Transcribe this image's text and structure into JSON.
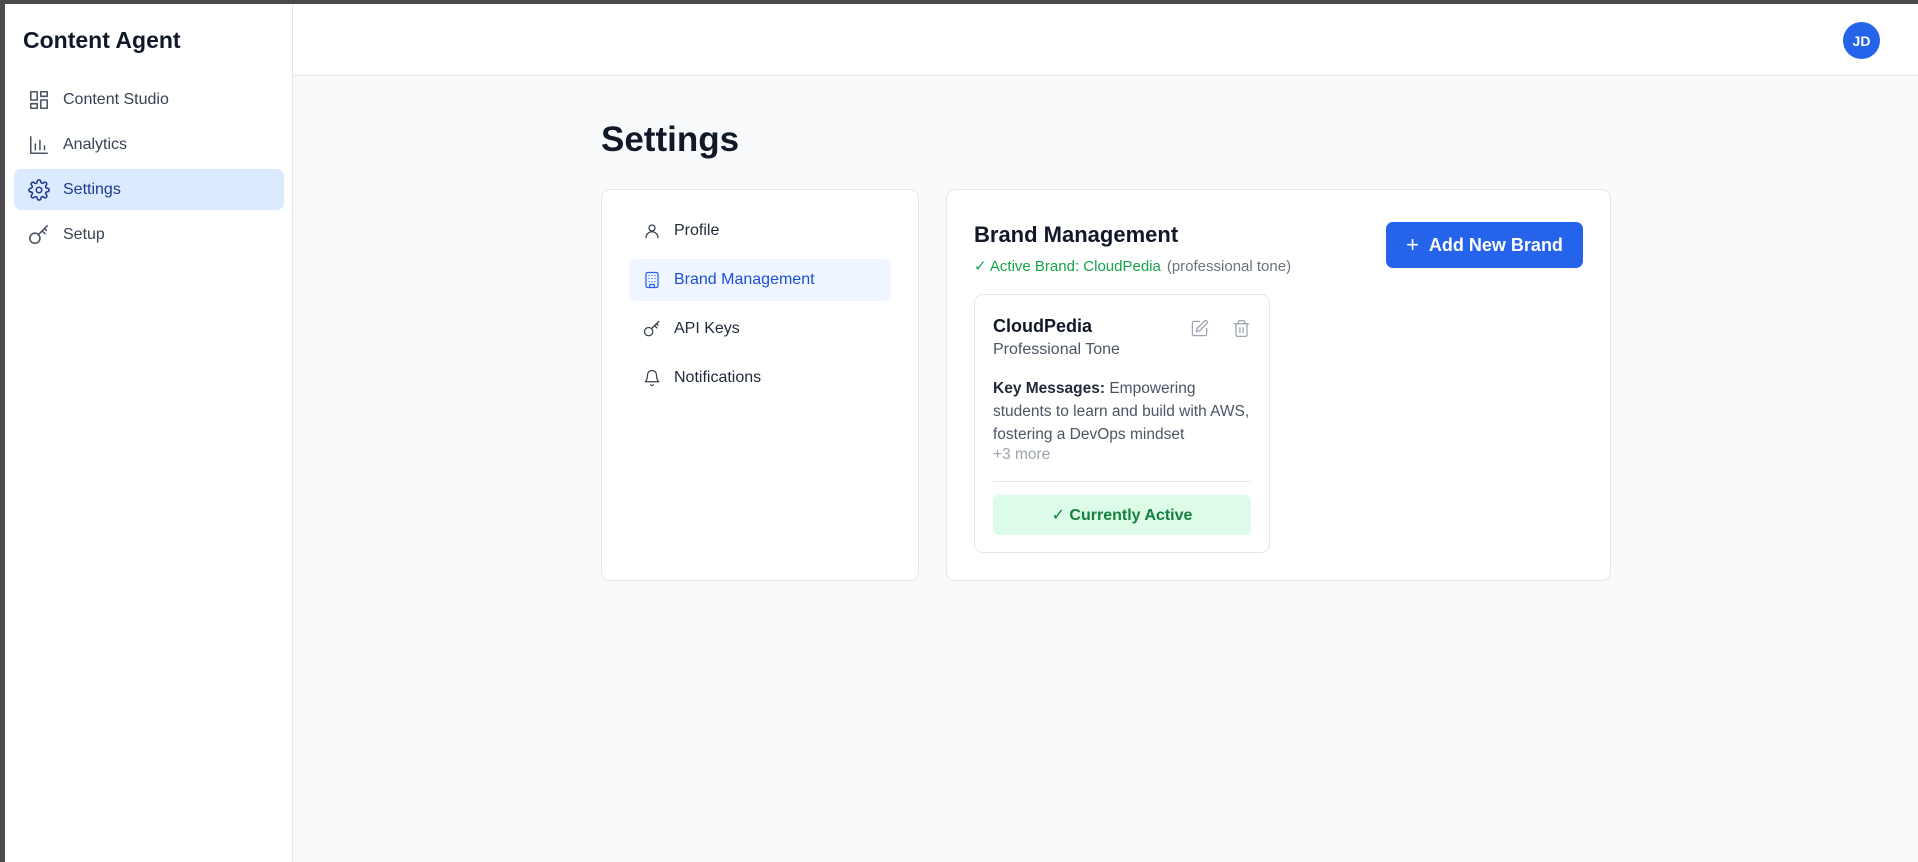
{
  "app": {
    "title": "Content Agent"
  },
  "sidebar": {
    "items": [
      {
        "label": "Content Studio",
        "icon": "layout-dashboard-icon"
      },
      {
        "label": "Analytics",
        "icon": "bar-chart-icon"
      },
      {
        "label": "Settings",
        "icon": "gear-icon",
        "active": true
      },
      {
        "label": "Setup",
        "icon": "key-icon"
      }
    ]
  },
  "header": {
    "avatar_initials": "JD"
  },
  "page": {
    "title": "Settings"
  },
  "settings_nav": {
    "items": [
      {
        "label": "Profile",
        "icon": "user-icon"
      },
      {
        "label": "Brand Management",
        "icon": "building-icon",
        "active": true
      },
      {
        "label": "API Keys",
        "icon": "key-icon"
      },
      {
        "label": "Notifications",
        "icon": "bell-icon"
      }
    ]
  },
  "brand_management": {
    "title": "Brand Management",
    "active_prefix": "✓ Active Brand: CloudPedia",
    "active_tone": "(professional tone)",
    "add_button_label": "Add New Brand",
    "brand_card": {
      "name": "CloudPedia",
      "tone": "Professional Tone",
      "key_messages_label": "Key Messages:",
      "key_messages": "Empowering students to learn and build with AWS, fostering a DevOps mindset",
      "more": "+3 more",
      "status": "✓ Currently Active"
    }
  },
  "colors": {
    "accent": "#2563eb",
    "active_green": "#16a34a",
    "active_bg": "#dcfce7",
    "sidebar_active_bg": "#dbeafe"
  }
}
